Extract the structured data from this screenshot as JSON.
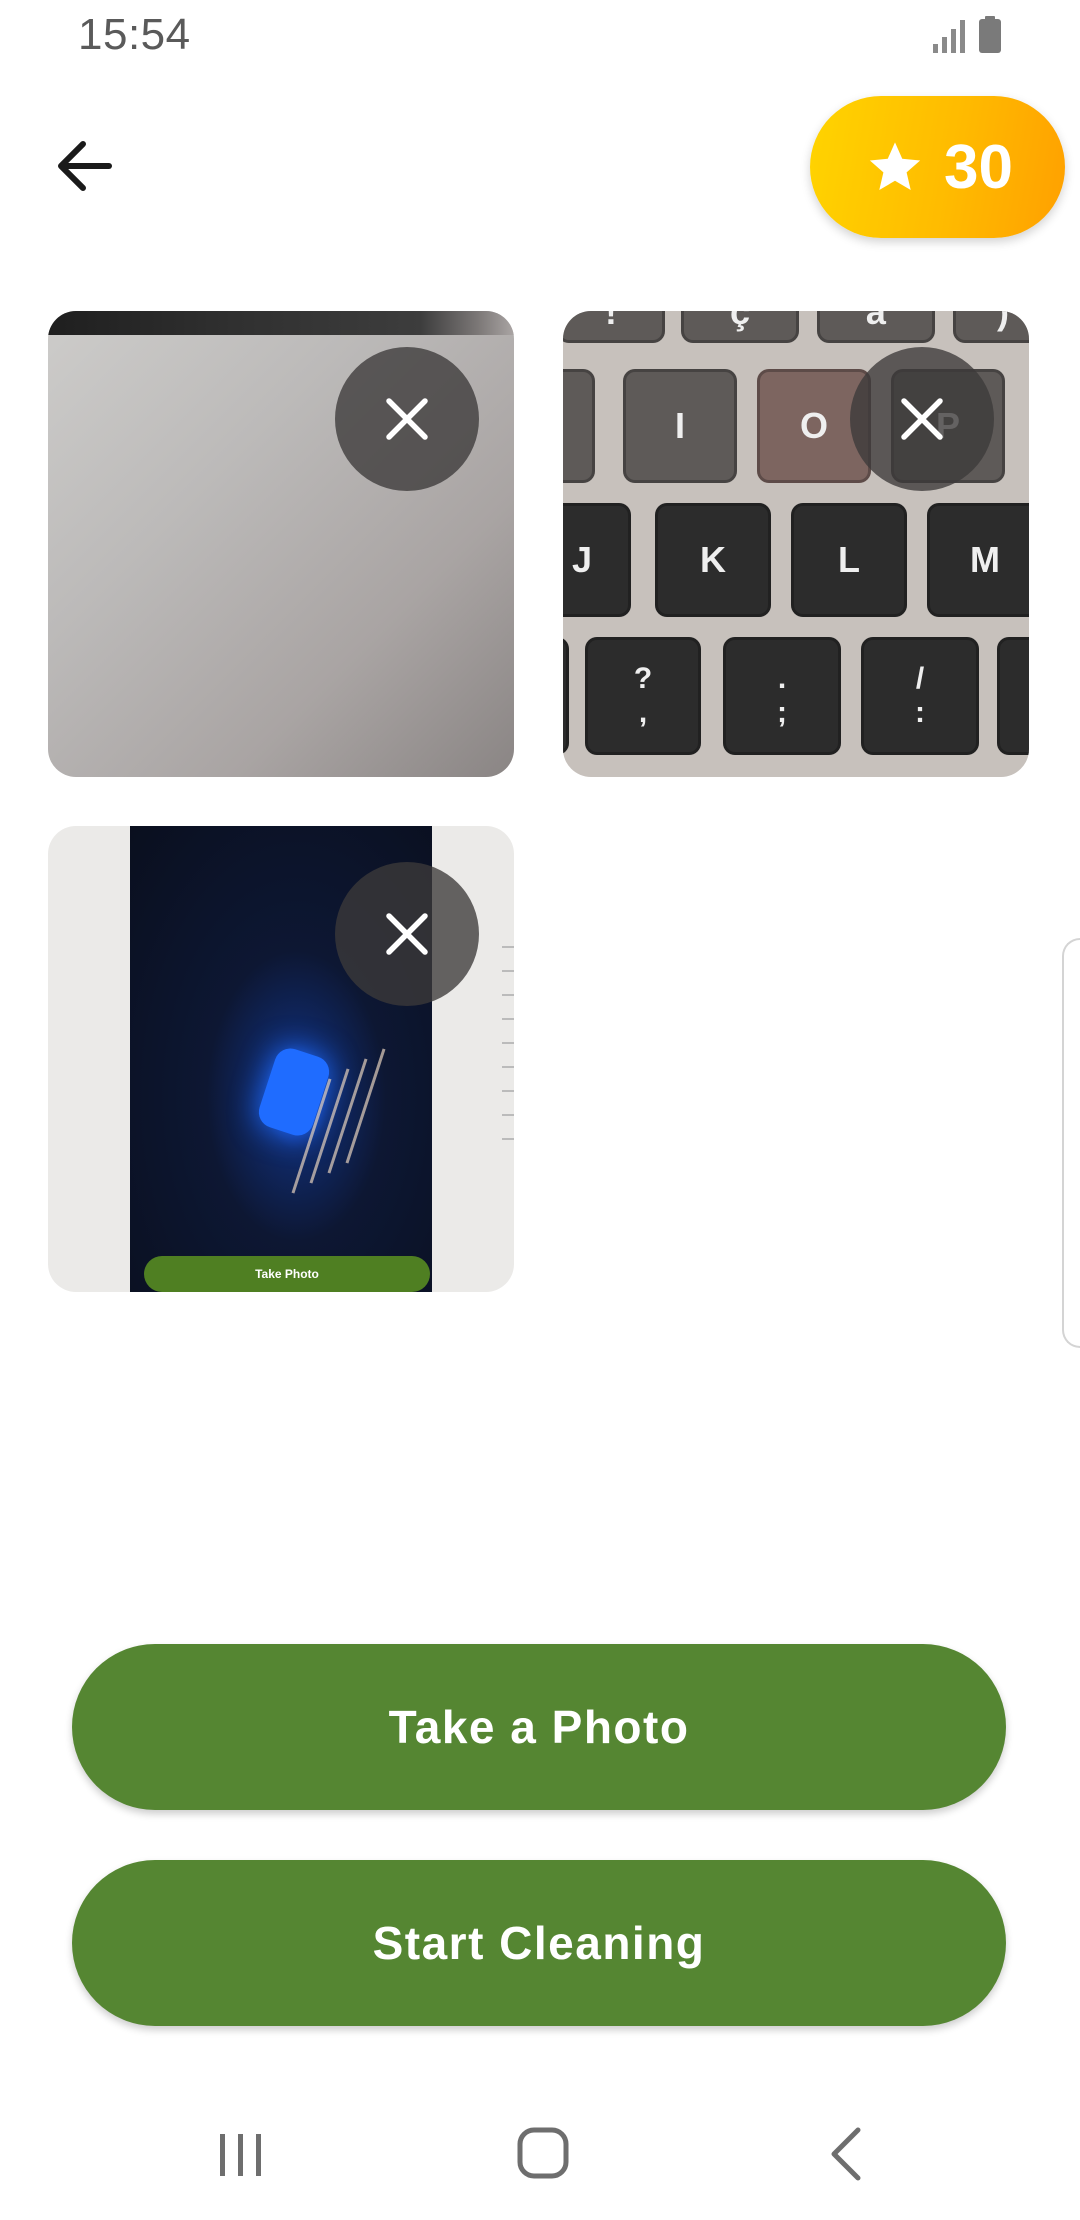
{
  "status_bar": {
    "time": "15:54",
    "icons": [
      "signal-icon",
      "battery-icon"
    ]
  },
  "header": {
    "back_icon": "arrow-left-icon",
    "points": {
      "icon": "star-icon",
      "value": "30",
      "gradient_colors": [
        "#ffd400",
        "#ffa000"
      ]
    }
  },
  "photos": [
    {
      "remove_icon": "close-icon",
      "subject": "gray surface"
    },
    {
      "remove_icon": "close-icon",
      "subject": "keyboard keys",
      "visible_key_labels": [
        "!",
        "ç",
        "à",
        ")",
        "I",
        "O",
        "P",
        "J",
        "K",
        "L",
        "M",
        "?",
        ",",
        ".",
        ";",
        "/",
        ":"
      ]
    },
    {
      "remove_icon": "close-icon",
      "subject": "phone screen",
      "embedded_button_text": "Take Photo"
    }
  ],
  "actions": {
    "take_photo_label": "Take a Photo",
    "start_cleaning_label": "Start Cleaning",
    "button_color": "#558632"
  },
  "nav_bar": {
    "icons": [
      "recents-icon",
      "home-icon",
      "back-icon"
    ]
  }
}
